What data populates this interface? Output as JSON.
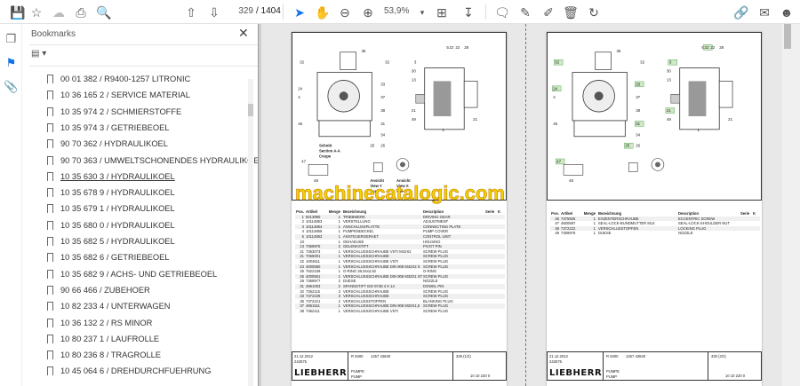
{
  "toolbar": {
    "page_current": "329",
    "page_total": "/ 1404",
    "zoom": "53,9%"
  },
  "bookmarks": {
    "title": "Bookmarks",
    "items": [
      "00 01 382 / R9400-1257 LITRONIC",
      "10 36 165 2 / SERVICE MATERIAL",
      "10 35 974 2 / SCHMIERSTOFFE",
      "10 35 974 3 / GETRIEBEOEL",
      "90 70 362 / HYDRAULIKOEL",
      "90 70 363 / UMWELTSCHONENDES HYDRAULIKOEL",
      "10 35 630 3 / HYDRAULIKOEL",
      "10 35 678 9 / HYDRAULIKOEL",
      "10 35 679 1 / HYDRAULIKOEL",
      "10 35 680 0 / HYDRAULIKOEL",
      "10 35 682 5 / HYDRAULIKOEL",
      "10 35 682 6 / GETRIEBEOEL",
      "10 35 682 9 / ACHS- UND GETRIEBEOEL",
      "90 66 466 / ZUBEHOER",
      "10 82 233 4 / UNTERWAGEN",
      "10 36 132 2 / RS MINOR",
      "10 80 237 1 / LAUFROLLE",
      "10 80 236 8 / TRAGROLLE",
      "10 45 064 6 / DREHDURCHFUEHRUNG"
    ],
    "selected_index": 6
  },
  "watermark": "machinecatalogic.com",
  "table_header": [
    "Pos.",
    "Artikel",
    "Menge",
    "Bezeichnung",
    "Description",
    "Serie",
    "K"
  ],
  "page1": {
    "labels": [
      "Schnitt",
      "Section A-A",
      "Coupe",
      "Ansicht",
      "View X",
      "Vue",
      "Ansicht",
      "View Y",
      "Vue"
    ],
    "rows": [
      [
        "1",
        "5013990",
        "1",
        "TRIEBWERK",
        "DRIVING GEAR"
      ],
      [
        "2",
        "10114863",
        "1",
        "VERSTELLUNG",
        "ADJUSTMENT"
      ],
      [
        "3",
        "10114864",
        "1",
        "ANSCHLUSSPLATTE",
        "CONNECTING PLATE"
      ],
      [
        "4",
        "10114866",
        "1",
        "PUMPENDECKEL",
        "PUMP COVER"
      ],
      [
        "5",
        "10114863",
        "1",
        "ANSTEUERGERAET",
        "CONTROL UNIT"
      ],
      [
        "10",
        "",
        "1",
        "GEHAEUSE",
        "HOUSING"
      ],
      [
        "13",
        "7369975",
        "2",
        "GELENKSTIFT",
        "PIVOT PIN"
      ],
      [
        "21",
        "7363073",
        "1",
        "VERSCHLUSSSCHRAUBE VSTI M42X2",
        "SCREW PLUG"
      ],
      [
        "21",
        "7055001",
        "1",
        "VERSCHLUSSSCHRAUBE",
        "SCREW PLUG"
      ],
      [
        "22",
        "1004611",
        "1",
        "VERSCHLUSSSCHRAUBE VSTI",
        "SCREW PLUG"
      ],
      [
        "24",
        "4000580",
        "1",
        "VERSCHLUSSSCHRAUBE DIN 908 M42X2 S",
        "SCREW PLUG"
      ],
      [
        "25",
        "7622159",
        "1",
        "O-RING 36,04x2,62",
        "O-RING"
      ],
      [
        "26",
        "4000561",
        "1",
        "VERSCHLUSSSCHRAUBE DIN 906 M33X1 ST",
        "SCREW PLUG"
      ],
      [
        "28",
        "7369977",
        "2",
        "DUESE",
        "NOZZLE"
      ],
      [
        "31",
        "4961003",
        "2",
        "SPANNSTIFT ISO 8748 4 X 14",
        "DOWEL PIN"
      ],
      [
        "32",
        "7362115",
        "3",
        "VERSCHLUSSSCHRAUBE",
        "SCREW PLUG"
      ],
      [
        "33",
        "7372229",
        "3",
        "VERSCHLUSSSCHRAUBE",
        "SCREW PLUG"
      ],
      [
        "35",
        "7372221",
        "2",
        "VERSCHLUSSSTOPFEN",
        "BLANKING PLUG"
      ],
      [
        "37",
        "4961511",
        "1",
        "VERSCHLUSSSCHRAUBE DIN 908 M20X1,5",
        "SCREW PLUG"
      ],
      [
        "38",
        "7362111",
        "1",
        "VERSCHLUSSSCHRAUBE VSTI",
        "SCREW PLUG"
      ]
    ],
    "footer": {
      "date": "21.12.2012",
      "code": "243075",
      "model": "R 9400",
      "number": "1257 43840",
      "name_de": "PUMPE",
      "name_en": "PUMP",
      "page": "329 (1/2)",
      "ref": "10 10 220 0",
      "brand": "LIEBHERR"
    }
  },
  "page2": {
    "rows": [
      [
        "46",
        "7375505",
        "1",
        "EXZENTERSCHRAUBE",
        "ECCENTRIC SCREW"
      ],
      [
        "47",
        "4600587",
        "1",
        "SEAL-LOCK-BUNDMUTTER M14",
        "SEAL-LOCK-SHOULDER NUT"
      ],
      [
        "48",
        "7372222",
        "1",
        "VERSCHLUSSTOPFEN",
        "LOCKING PLUG"
      ],
      [
        "49",
        "7369976",
        "1",
        "DUESE",
        "NOZZLE"
      ]
    ],
    "footer": {
      "date": "21.12.2012",
      "code": "243075",
      "model": "R 9400",
      "number": "1257 43840",
      "name_de": "PUMPE",
      "name_en": "PUMP",
      "page": "330 (2/2)",
      "ref": "10 10 220 0",
      "brand": "LIEBHERR"
    }
  },
  "callouts": [
    "32",
    "35",
    "32",
    "24",
    "4",
    "46",
    "33",
    "37",
    "38",
    "31",
    "34",
    "5",
    "22",
    "22",
    "28",
    "3",
    "30",
    "13",
    "21",
    "49",
    "21",
    "47",
    "48",
    "26",
    "25",
    "1"
  ]
}
